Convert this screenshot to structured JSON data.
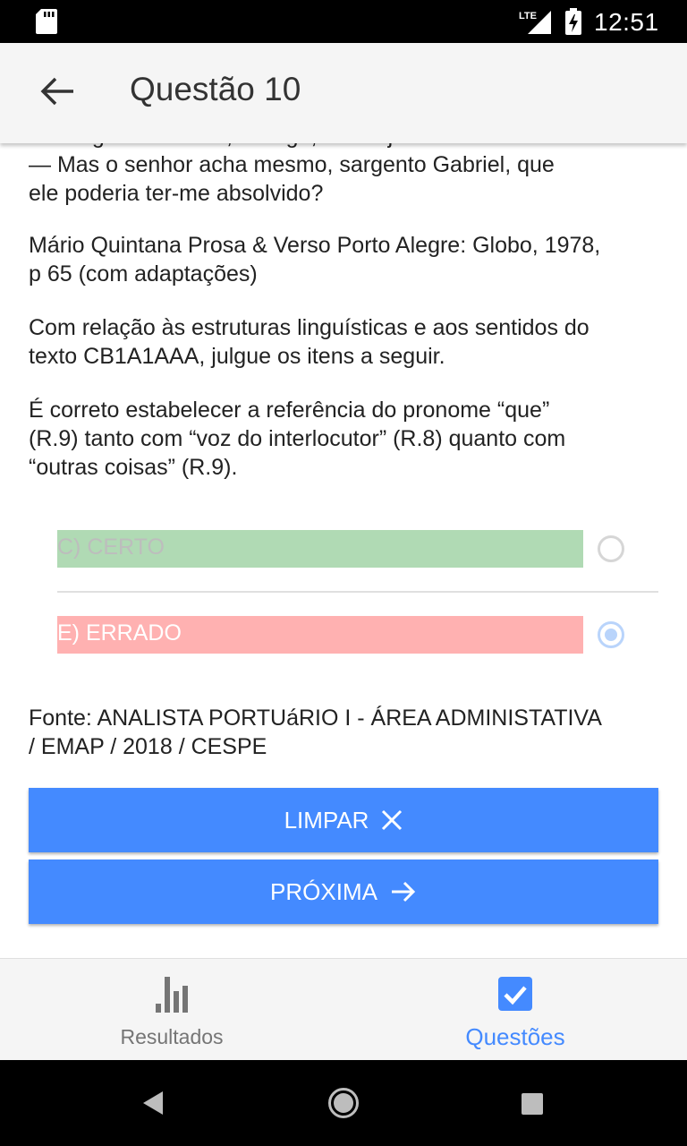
{
  "status_bar": {
    "time": "12:51",
    "network": "LTE"
  },
  "header": {
    "title": "Questão 10"
  },
  "question": {
    "clipped_line": "— Sargento Gabriel, contigo, assim já",
    "lines": [
      "— Mas o senhor acha mesmo, sargento Gabriel, que\nele poderia ter-me absolvido?",
      "Mário Quintana Prosa & Verso Porto Alegre: Globo, 1978,\np 65 (com adaptações)",
      "Com relação às estruturas linguísticas e aos sentidos do\ntexto CB1A1AAA, julgue os itens a seguir.",
      "É correto estabelecer a referência do pronome “que”\n(R.9) tanto com “voz do interlocutor” (R.8) quanto com\n“outras coisas” (R.9)."
    ],
    "options": [
      {
        "label": "C) CERTO",
        "selected": false,
        "color": "#b0dab4"
      },
      {
        "label": "E) ERRADO",
        "selected": true,
        "color": "#ffb1b1"
      }
    ],
    "source": "Fonte: ANALISTA PORTUáRIO I - ÁREA ADMINISTATIVA\n/ EMAP / 2018 / CESPE"
  },
  "buttons": {
    "clear_label": "LIMPAR",
    "next_label": "PRÓXIMA",
    "color": "#448aff"
  },
  "bottom_nav": {
    "items": [
      {
        "label": "Resultados",
        "icon": "bar-chart-icon",
        "active": false
      },
      {
        "label": "Questões",
        "icon": "checkbox-icon",
        "active": true
      }
    ]
  }
}
